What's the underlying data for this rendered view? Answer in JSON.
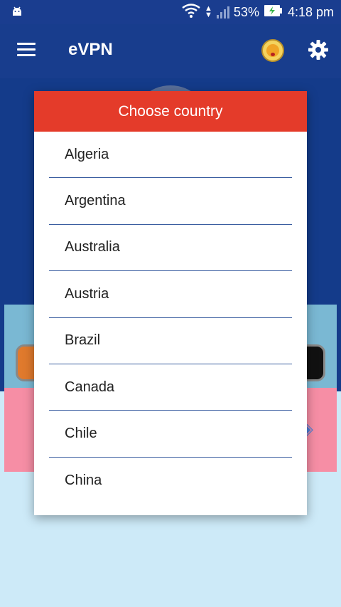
{
  "status_bar": {
    "battery": "53%",
    "time": "4:18 pm"
  },
  "app_bar": {
    "title": "eVPN"
  },
  "dialog": {
    "title": "Choose country",
    "countries": [
      "Algeria",
      "Argentina",
      "Australia",
      "Austria",
      "Brazil",
      "Canada",
      "Chile",
      "China"
    ]
  },
  "colors": {
    "primary": "#183d8d",
    "dialog_header": "#e43b2a",
    "divider": "#3a5da0"
  },
  "icons": [
    "android-icon",
    "wifi-icon",
    "signal-icon",
    "battery-charging-icon",
    "menu-icon",
    "emoji-icon",
    "gear-icon"
  ]
}
